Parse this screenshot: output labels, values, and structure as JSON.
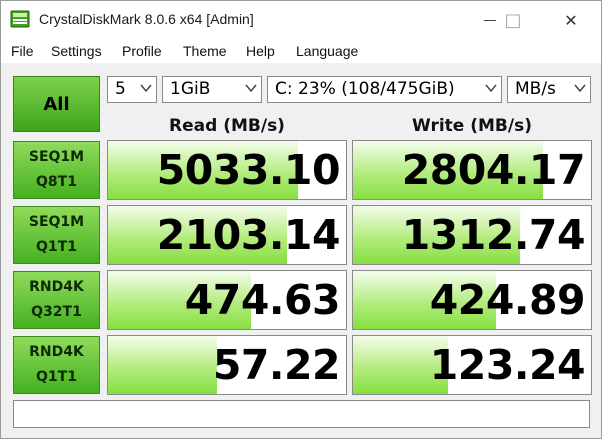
{
  "window": {
    "title": "CrystalDiskMark 8.0.6 x64 [Admin]",
    "controls": {
      "minimize": "—",
      "maximize": "□",
      "close": "✕"
    }
  },
  "menu": [
    "File",
    "Settings",
    "Profile",
    "Theme",
    "Help",
    "Language"
  ],
  "toolbar": {
    "all_label": "All",
    "count": "5",
    "size": "1GiB",
    "drive": "C: 23% (108/475GiB)",
    "unit": "MB/s"
  },
  "headers": {
    "read": "Read (MB/s)",
    "write": "Write (MB/s)"
  },
  "colors": {
    "accent_green": "#7ed24a",
    "bar_green": "#86df40"
  },
  "tests": [
    {
      "line1": "SEQ1M",
      "line2": "Q8T1",
      "read": "5033.10",
      "write": "2804.17",
      "read_fill": 0.8,
      "write_fill": 0.8
    },
    {
      "line1": "SEQ1M",
      "line2": "Q1T1",
      "read": "2103.14",
      "write": "1312.74",
      "read_fill": 0.75,
      "write_fill": 0.7
    },
    {
      "line1": "RND4K",
      "line2": "Q32T1",
      "read": "474.63",
      "write": "424.89",
      "read_fill": 0.6,
      "write_fill": 0.6
    },
    {
      "line1": "RND4K",
      "line2": "Q1T1",
      "read": "57.22",
      "write": "123.24",
      "read_fill": 0.46,
      "write_fill": 0.4
    }
  ],
  "comment": ""
}
